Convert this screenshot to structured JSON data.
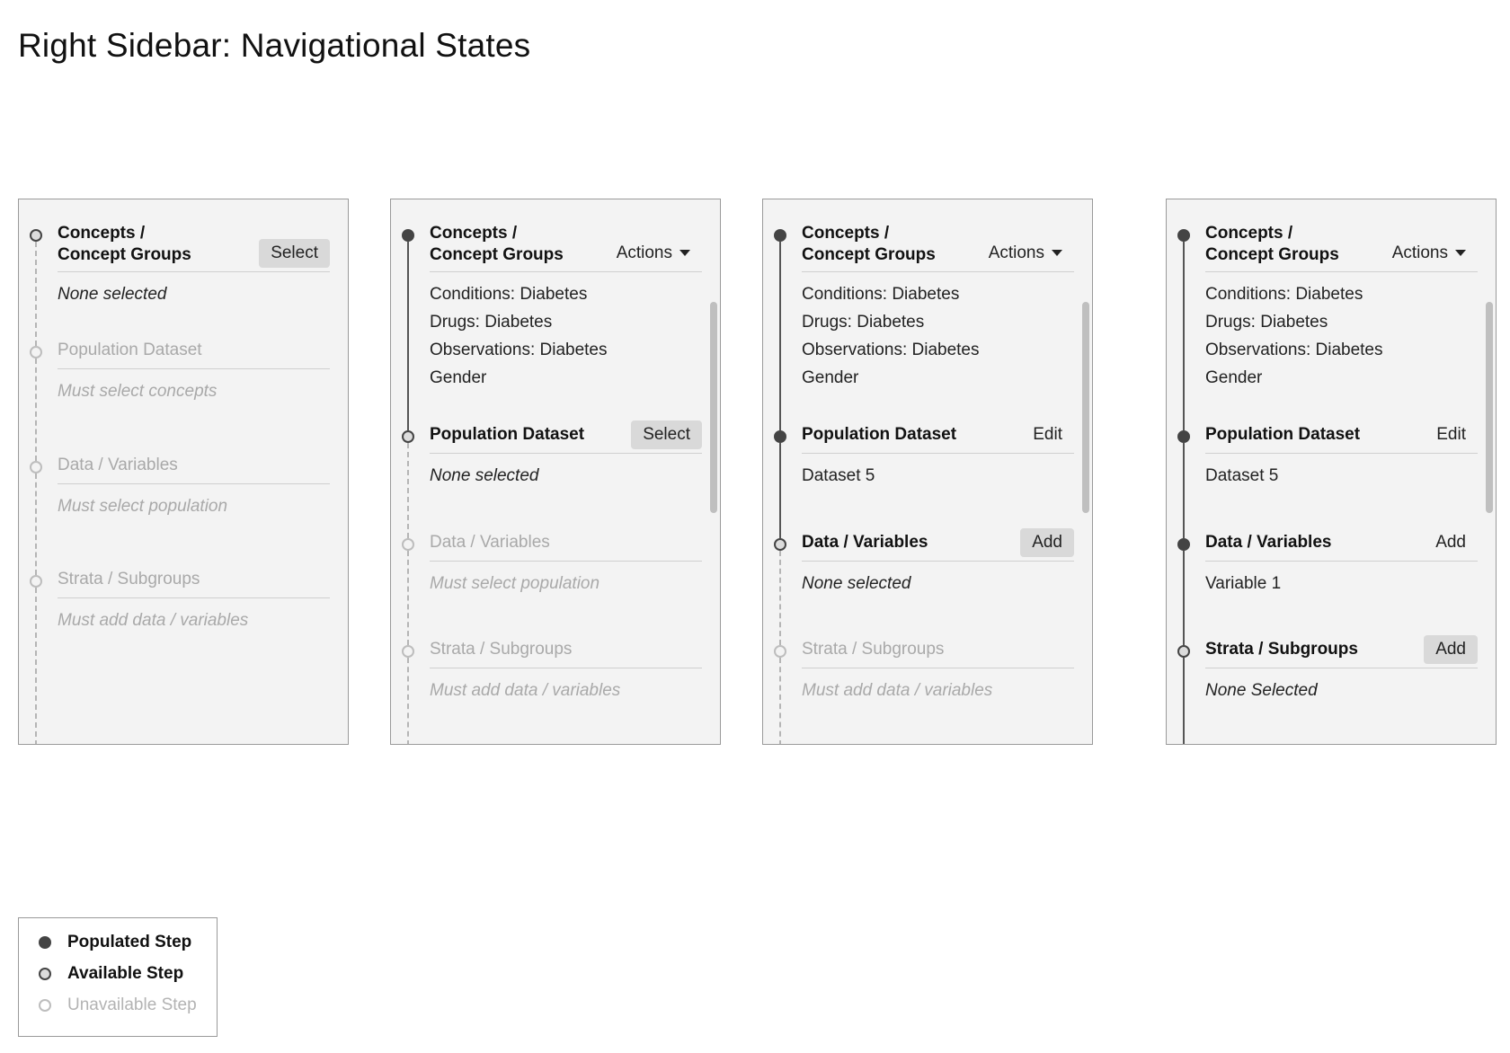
{
  "page": {
    "title": "Right Sidebar: Navigational States"
  },
  "panels": [
    {
      "steps": [
        {
          "title": "Concepts /\nConcept Groups",
          "state": "available",
          "button": "Select",
          "button_style": "filled",
          "body": [
            "None selected"
          ],
          "body_style": "italic"
        },
        {
          "title": "Population Dataset",
          "state": "unavailable",
          "button": "",
          "body": [
            "Must select concepts"
          ],
          "body_style": "muted"
        },
        {
          "title": "Data / Variables",
          "state": "unavailable",
          "button": "",
          "body": [
            "Must select population"
          ],
          "body_style": "muted"
        },
        {
          "title": "Strata / Subgroups",
          "state": "unavailable",
          "button": "",
          "body": [
            "Must add data / variables"
          ],
          "body_style": "muted"
        }
      ]
    },
    {
      "steps": [
        {
          "title": "Concepts /\nConcept Groups",
          "state": "populated",
          "button": "Actions",
          "button_style": "dropdown",
          "body": [
            "Conditions: Diabetes",
            "Drugs: Diabetes",
            "Observations: Diabetes",
            "Gender"
          ],
          "body_style": "normal"
        },
        {
          "title": "Population Dataset",
          "state": "available",
          "button": "Select",
          "button_style": "filled",
          "body": [
            "None selected"
          ],
          "body_style": "italic"
        },
        {
          "title": "Data / Variables",
          "state": "unavailable",
          "button": "",
          "body": [
            "Must select population"
          ],
          "body_style": "muted"
        },
        {
          "title": "Strata / Subgroups",
          "state": "unavailable",
          "button": "",
          "body": [
            "Must add data / variables"
          ],
          "body_style": "muted"
        }
      ]
    },
    {
      "steps": [
        {
          "title": "Concepts /\nConcept Groups",
          "state": "populated",
          "button": "Actions",
          "button_style": "dropdown",
          "body": [
            "Conditions: Diabetes",
            "Drugs: Diabetes",
            "Observations: Diabetes",
            "Gender"
          ],
          "body_style": "normal"
        },
        {
          "title": "Population Dataset",
          "state": "populated",
          "button": "Edit",
          "button_style": "plain",
          "body": [
            "Dataset 5"
          ],
          "body_style": "normal"
        },
        {
          "title": "Data / Variables",
          "state": "available",
          "button": "Add",
          "button_style": "filled",
          "body": [
            "None selected"
          ],
          "body_style": "italic"
        },
        {
          "title": "Strata / Subgroups",
          "state": "unavailable",
          "button": "",
          "body": [
            "Must add data / variables"
          ],
          "body_style": "muted"
        }
      ]
    },
    {
      "steps": [
        {
          "title": "Concepts /\nConcept Groups",
          "state": "populated",
          "button": "Actions",
          "button_style": "dropdown",
          "body": [
            "Conditions: Diabetes",
            "Drugs: Diabetes",
            "Observations: Diabetes",
            "Gender"
          ],
          "body_style": "normal"
        },
        {
          "title": "Population Dataset",
          "state": "populated",
          "button": "Edit",
          "button_style": "plain",
          "body": [
            "Dataset 5"
          ],
          "body_style": "normal"
        },
        {
          "title": "Data / Variables",
          "state": "populated",
          "button": "Add",
          "button_style": "plain",
          "body": [
            "Variable 1"
          ],
          "body_style": "normal"
        },
        {
          "title": "Strata / Subgroups",
          "state": "available",
          "button": "Add",
          "button_style": "filled",
          "body": [
            "None Selected"
          ],
          "body_style": "italic"
        }
      ]
    }
  ],
  "legend": {
    "items": [
      {
        "label": "Populated Step",
        "state": "populated"
      },
      {
        "label": "Available Step",
        "state": "available"
      },
      {
        "label": "Unavailable Step",
        "state": "unavailable"
      }
    ]
  },
  "colors": {
    "populated": "#444444",
    "available_fill": "#dcdcdc",
    "unavailable": "#bdbdbd",
    "panel_bg": "#f3f3f3",
    "button_bg": "#d9d9d9"
  },
  "icons": {
    "populated": "filled-circle-icon",
    "available": "ring-circle-icon",
    "unavailable": "hollow-circle-icon",
    "dropdown": "caret-down-icon"
  }
}
